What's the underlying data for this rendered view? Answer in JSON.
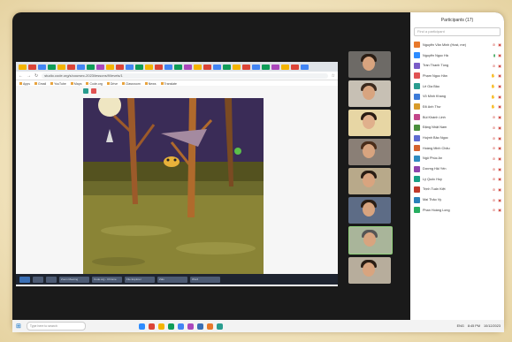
{
  "panel": {
    "title": "Participants (17)",
    "search_placeholder": "Find a participant",
    "invite_label": "Invite",
    "mute_all_label": "Mute All",
    "participants": [
      {
        "name": "Nguyễn Văn Minh (Host, me)",
        "color": "#e8792b",
        "status": "mic-off"
      },
      {
        "name": "Nguyễn Ngọc Hà",
        "color": "#2d8cff",
        "status": "mic-on"
      },
      {
        "name": "Trần Thanh Tùng",
        "color": "#7a5cc7",
        "status": "mic-off"
      },
      {
        "name": "Phạm Ngọc Hân",
        "color": "#e05353",
        "status": "hand"
      },
      {
        "name": "Lê Gia Bảo",
        "color": "#2a9d8f",
        "status": "hand"
      },
      {
        "name": "Võ Minh Khang",
        "color": "#3d7bd8",
        "status": "hand"
      },
      {
        "name": "Đỗ Anh Thư",
        "color": "#d89b2a",
        "status": "hand"
      },
      {
        "name": "Bùi Khánh Linh",
        "color": "#c2458a",
        "status": "mic-off"
      },
      {
        "name": "Đặng Nhật Nam",
        "color": "#4a8f3d",
        "status": "mic-off"
      },
      {
        "name": "Huỳnh Bảo Ngọc",
        "color": "#5e6bd1",
        "status": "mic-off"
      },
      {
        "name": "Hoàng Minh Châu",
        "color": "#d4622e",
        "status": "mic-off"
      },
      {
        "name": "Ngô Phúc An",
        "color": "#2e8bc0",
        "status": "mic-off"
      },
      {
        "name": "Dương Hải Yến",
        "color": "#8e44ad",
        "status": "mic-off"
      },
      {
        "name": "Lý Quốc Huy",
        "color": "#16a085",
        "status": "mic-off"
      },
      {
        "name": "Trịnh Tuấn Kiệt",
        "color": "#c0392b",
        "status": "mic-off"
      },
      {
        "name": "Mai Thảo Vy",
        "color": "#2980b9",
        "status": "mic-off"
      },
      {
        "name": "Phan Hoàng Long",
        "color": "#27ae60",
        "status": "mic-off"
      }
    ]
  },
  "browser": {
    "url": "studio.code.org/s/coursec-2023/lessons/9/levels/1",
    "bookmarks": [
      "Apps",
      "Gmail",
      "YouTube",
      "Maps",
      "Code.org",
      "Drive",
      "Classroom",
      "News",
      "Translate"
    ]
  },
  "taskbar": {
    "search_placeholder": "Type here to search",
    "time": "8:45 PM",
    "date": "10/12/2023",
    "lang": "ENG",
    "apps": [
      "Zoom Meeting",
      "Code.org - Chrome",
      "File Explorer",
      "Zalo",
      "Word"
    ]
  },
  "colors": {
    "accent": "#2d8cff",
    "hand": "#e3a917",
    "muted": "#d0443c"
  }
}
